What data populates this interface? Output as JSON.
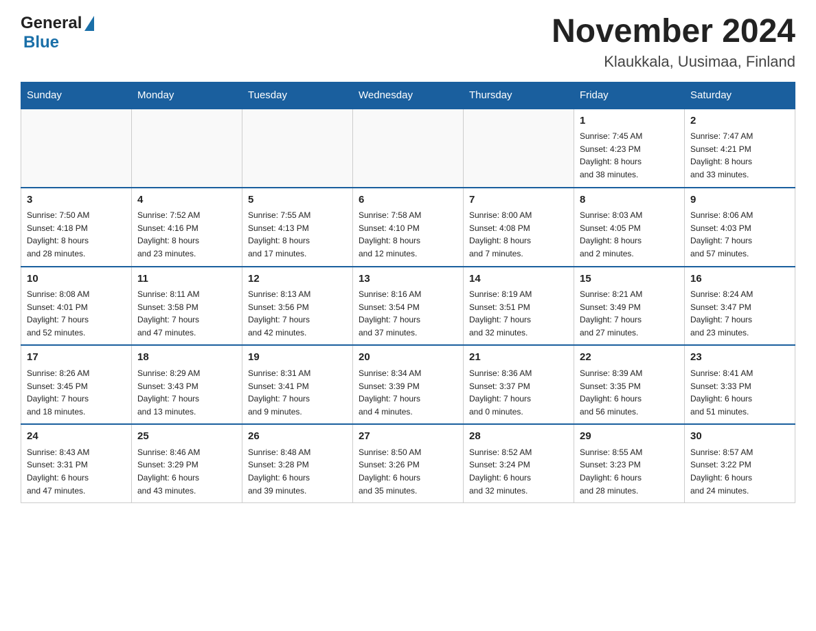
{
  "header": {
    "logo_general": "General",
    "logo_blue": "Blue",
    "month_title": "November 2024",
    "location": "Klaukkala, Uusimaa, Finland"
  },
  "weekdays": [
    "Sunday",
    "Monday",
    "Tuesday",
    "Wednesday",
    "Thursday",
    "Friday",
    "Saturday"
  ],
  "weeks": [
    [
      {
        "day": "",
        "info": ""
      },
      {
        "day": "",
        "info": ""
      },
      {
        "day": "",
        "info": ""
      },
      {
        "day": "",
        "info": ""
      },
      {
        "day": "",
        "info": ""
      },
      {
        "day": "1",
        "info": "Sunrise: 7:45 AM\nSunset: 4:23 PM\nDaylight: 8 hours\nand 38 minutes."
      },
      {
        "day": "2",
        "info": "Sunrise: 7:47 AM\nSunset: 4:21 PM\nDaylight: 8 hours\nand 33 minutes."
      }
    ],
    [
      {
        "day": "3",
        "info": "Sunrise: 7:50 AM\nSunset: 4:18 PM\nDaylight: 8 hours\nand 28 minutes."
      },
      {
        "day": "4",
        "info": "Sunrise: 7:52 AM\nSunset: 4:16 PM\nDaylight: 8 hours\nand 23 minutes."
      },
      {
        "day": "5",
        "info": "Sunrise: 7:55 AM\nSunset: 4:13 PM\nDaylight: 8 hours\nand 17 minutes."
      },
      {
        "day": "6",
        "info": "Sunrise: 7:58 AM\nSunset: 4:10 PM\nDaylight: 8 hours\nand 12 minutes."
      },
      {
        "day": "7",
        "info": "Sunrise: 8:00 AM\nSunset: 4:08 PM\nDaylight: 8 hours\nand 7 minutes."
      },
      {
        "day": "8",
        "info": "Sunrise: 8:03 AM\nSunset: 4:05 PM\nDaylight: 8 hours\nand 2 minutes."
      },
      {
        "day": "9",
        "info": "Sunrise: 8:06 AM\nSunset: 4:03 PM\nDaylight: 7 hours\nand 57 minutes."
      }
    ],
    [
      {
        "day": "10",
        "info": "Sunrise: 8:08 AM\nSunset: 4:01 PM\nDaylight: 7 hours\nand 52 minutes."
      },
      {
        "day": "11",
        "info": "Sunrise: 8:11 AM\nSunset: 3:58 PM\nDaylight: 7 hours\nand 47 minutes."
      },
      {
        "day": "12",
        "info": "Sunrise: 8:13 AM\nSunset: 3:56 PM\nDaylight: 7 hours\nand 42 minutes."
      },
      {
        "day": "13",
        "info": "Sunrise: 8:16 AM\nSunset: 3:54 PM\nDaylight: 7 hours\nand 37 minutes."
      },
      {
        "day": "14",
        "info": "Sunrise: 8:19 AM\nSunset: 3:51 PM\nDaylight: 7 hours\nand 32 minutes."
      },
      {
        "day": "15",
        "info": "Sunrise: 8:21 AM\nSunset: 3:49 PM\nDaylight: 7 hours\nand 27 minutes."
      },
      {
        "day": "16",
        "info": "Sunrise: 8:24 AM\nSunset: 3:47 PM\nDaylight: 7 hours\nand 23 minutes."
      }
    ],
    [
      {
        "day": "17",
        "info": "Sunrise: 8:26 AM\nSunset: 3:45 PM\nDaylight: 7 hours\nand 18 minutes."
      },
      {
        "day": "18",
        "info": "Sunrise: 8:29 AM\nSunset: 3:43 PM\nDaylight: 7 hours\nand 13 minutes."
      },
      {
        "day": "19",
        "info": "Sunrise: 8:31 AM\nSunset: 3:41 PM\nDaylight: 7 hours\nand 9 minutes."
      },
      {
        "day": "20",
        "info": "Sunrise: 8:34 AM\nSunset: 3:39 PM\nDaylight: 7 hours\nand 4 minutes."
      },
      {
        "day": "21",
        "info": "Sunrise: 8:36 AM\nSunset: 3:37 PM\nDaylight: 7 hours\nand 0 minutes."
      },
      {
        "day": "22",
        "info": "Sunrise: 8:39 AM\nSunset: 3:35 PM\nDaylight: 6 hours\nand 56 minutes."
      },
      {
        "day": "23",
        "info": "Sunrise: 8:41 AM\nSunset: 3:33 PM\nDaylight: 6 hours\nand 51 minutes."
      }
    ],
    [
      {
        "day": "24",
        "info": "Sunrise: 8:43 AM\nSunset: 3:31 PM\nDaylight: 6 hours\nand 47 minutes."
      },
      {
        "day": "25",
        "info": "Sunrise: 8:46 AM\nSunset: 3:29 PM\nDaylight: 6 hours\nand 43 minutes."
      },
      {
        "day": "26",
        "info": "Sunrise: 8:48 AM\nSunset: 3:28 PM\nDaylight: 6 hours\nand 39 minutes."
      },
      {
        "day": "27",
        "info": "Sunrise: 8:50 AM\nSunset: 3:26 PM\nDaylight: 6 hours\nand 35 minutes."
      },
      {
        "day": "28",
        "info": "Sunrise: 8:52 AM\nSunset: 3:24 PM\nDaylight: 6 hours\nand 32 minutes."
      },
      {
        "day": "29",
        "info": "Sunrise: 8:55 AM\nSunset: 3:23 PM\nDaylight: 6 hours\nand 28 minutes."
      },
      {
        "day": "30",
        "info": "Sunrise: 8:57 AM\nSunset: 3:22 PM\nDaylight: 6 hours\nand 24 minutes."
      }
    ]
  ]
}
